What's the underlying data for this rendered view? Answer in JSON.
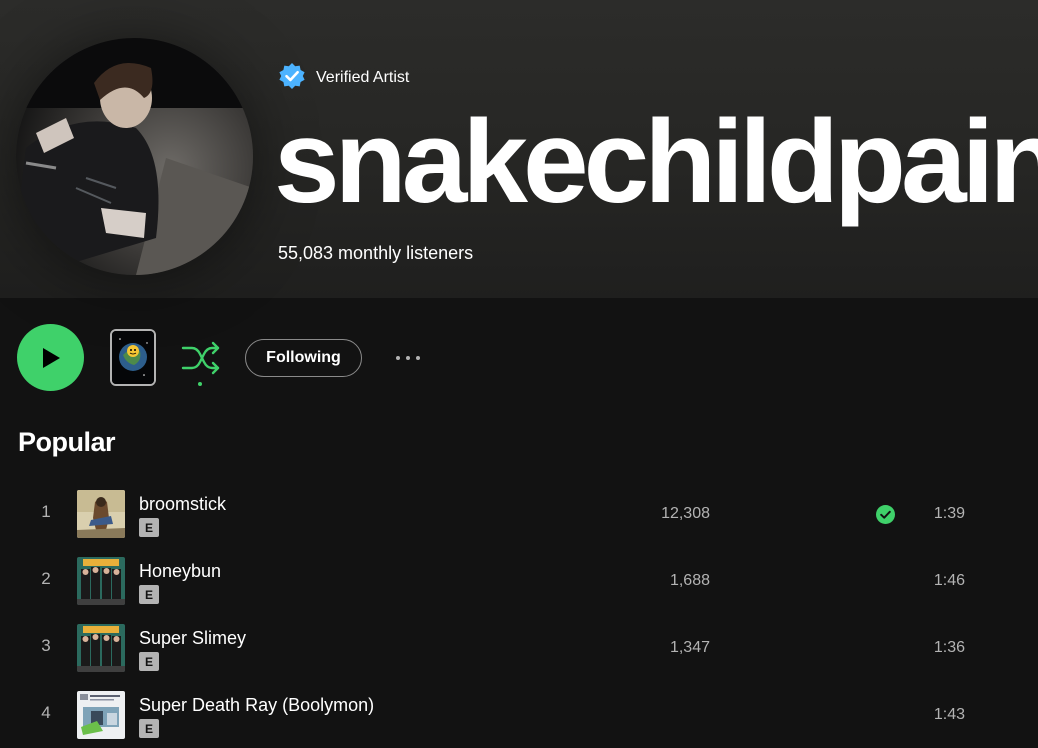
{
  "artist": {
    "verified_label": "Verified Artist",
    "name": "snakechildpain",
    "monthly_listeners": "55,083 monthly listeners"
  },
  "controls": {
    "follow_label": "Following",
    "accent_color": "#3fd16a"
  },
  "popular": {
    "title": "Popular",
    "tracks": [
      {
        "number": "1",
        "title": "broomstick",
        "explicit": "E",
        "plays": "12,308",
        "saved": true,
        "duration": "1:39"
      },
      {
        "number": "2",
        "title": "Honeybun",
        "explicit": "E",
        "plays": "1,688",
        "saved": false,
        "duration": "1:46"
      },
      {
        "number": "3",
        "title": "Super Slimey",
        "explicit": "E",
        "plays": "1,347",
        "saved": false,
        "duration": "1:36"
      },
      {
        "number": "4",
        "title": "Super Death Ray (Boolymon)",
        "explicit": "E",
        "plays": "",
        "saved": false,
        "duration": "1:43"
      }
    ]
  }
}
